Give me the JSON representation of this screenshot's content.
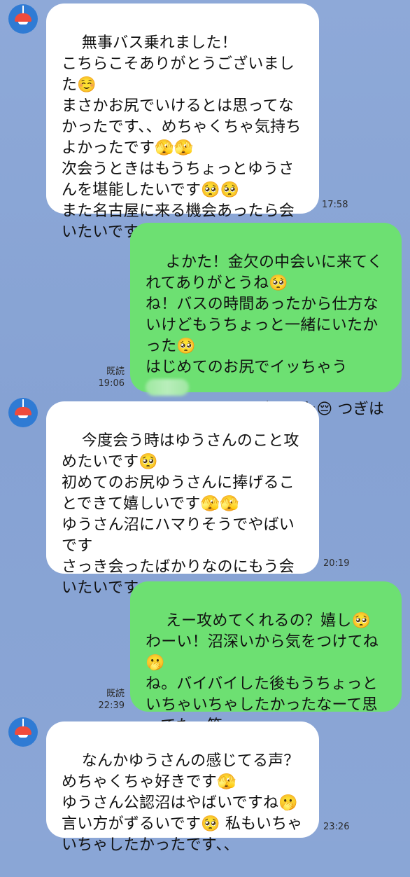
{
  "messages": [
    {
      "side": "in",
      "text": "無事バス乗れました！\nこちらこそありがとうございました☺️\nまさかお尻でいけるとは思ってなかったです、、めちゃくちゃ気持ちよかったです🫣🫣\n次会うときはもうちょっとゆうさんを堪能したいです🥺🥺\nまた名古屋に来る機会あったら会いたいです！！",
      "time": "17:58"
    },
    {
      "side": "out",
      "text": "よかた！金欠の中会いに来てくれてありがとうね🥺\nね！バスの時間あったから仕方ないけどもうちょっと一緒にいたかった🥺\nはじめてのお尻でイッちゃう",
      "text_after_blur": "\nちゃんえっちすぎでした😔 つぎは名古屋で会おうね〜！",
      "read": "既読",
      "time": "19:06"
    },
    {
      "side": "in",
      "text": "今度会う時はゆうさんのこと攻めたいです🥺\n初めてのお尻ゆうさんに捧げることできて嬉しいです🫣🫣\nゆうさん沼にハマりそうでやばいです\nさっき会ったばかりなのにもう会いたいです",
      "time": "20:19"
    },
    {
      "side": "out",
      "text": "えー攻めてくれるの？嬉し🥺\nわーい！沼深いから気をつけてね🫢\nね。バイバイした後もうちょっといちゃいちゃしたかったなーて思ってた。笑",
      "read": "既読",
      "time": "22:39"
    },
    {
      "side": "in",
      "text": "なんかゆうさんの感じてる声？めちゃくちゃ好きです🫣\nゆうさん公認沼はやばいですね🫢\n言い方がずるいです🥺 私もいちゃいちゃしたかったです、、",
      "time": "23:26"
    }
  ],
  "colors": {
    "background": "#8aa6d6",
    "incoming_bubble": "#ffffff",
    "outgoing_bubble": "#6de072",
    "avatar": "#2f7bd4",
    "lamp": "#ef4b3c"
  },
  "icons": {
    "avatar": "red-lamp-icon"
  }
}
